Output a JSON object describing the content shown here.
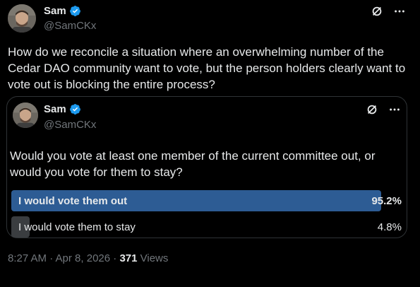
{
  "post": {
    "author": {
      "display_name": "Sam",
      "handle": "@SamCKx"
    },
    "text": "How do we reconcile a situation where an overwhelming number of the Cedar DAO community want to vote, but the person holders clearly want to vote out is blocking the entire process?",
    "timestamp": "8:27 AM · Apr 8, 2026 · ",
    "views_count": "371",
    "views_label": " Views"
  },
  "quote": {
    "author": {
      "display_name": "Sam",
      "handle": "@SamCKx"
    },
    "text": "Would you vote at least one member of the current committee out, or would you vote for them to stay?",
    "poll": {
      "options": [
        {
          "label": "I would vote them out",
          "percent": "95.2%",
          "fraction": 0.952,
          "winner": true
        },
        {
          "label": "I would vote them to stay",
          "percent": "4.8%",
          "fraction": 0.048,
          "winner": false
        }
      ]
    }
  },
  "icons": {
    "verified": "verified-badge-icon",
    "grok": "grok-icon",
    "more": "more-icon"
  },
  "colors": {
    "background": "#000000",
    "text": "#e7e9ea",
    "muted": "#71767b",
    "verified": "#1d9bf0",
    "poll_winner": "#2d5c94",
    "poll_other": "#3a3d40",
    "border": "#2f3336"
  }
}
